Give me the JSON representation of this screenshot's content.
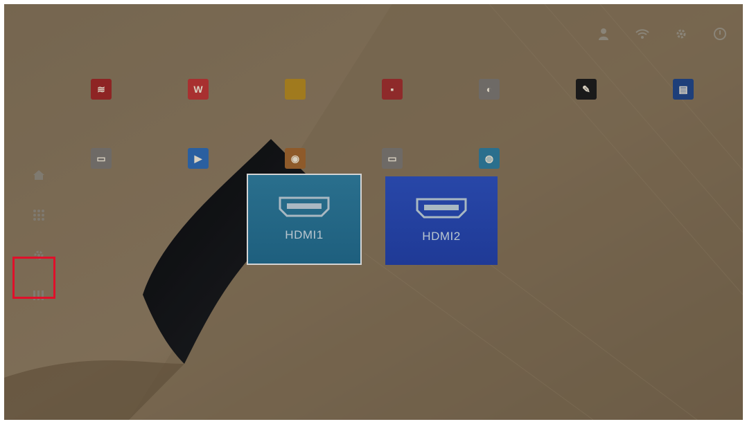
{
  "status_bar": {
    "icons": [
      "person-icon",
      "wifi-icon",
      "gear-icon",
      "power-icon"
    ]
  },
  "apps": {
    "row1": [
      {
        "label": "",
        "color": "#8e2424",
        "glyph": "≋"
      },
      {
        "label": "",
        "color": "#a83030",
        "glyph": "W"
      },
      {
        "label": "",
        "color": "#a07a1e",
        "glyph": ""
      },
      {
        "label": "",
        "color": "#8e2a2a",
        "glyph": "▪"
      },
      {
        "label": "",
        "color": "#6e6a66",
        "glyph": "◐"
      },
      {
        "label": "",
        "color": "#1a1a1a",
        "glyph": "✎"
      },
      {
        "label": "",
        "color": "#1e3f7a",
        "glyph": "▤"
      }
    ],
    "row2": [
      {
        "label": "",
        "color": "#6e6a66",
        "glyph": "▭"
      },
      {
        "label": "",
        "color": "#2a5fa0",
        "glyph": "▶"
      },
      {
        "label": "",
        "color": "#8e5a2a",
        "glyph": "◉"
      },
      {
        "label": "",
        "color": "#6e6a66",
        "glyph": "▭"
      },
      {
        "label": "",
        "color": "#2a6f8d",
        "glyph": "◍"
      }
    ]
  },
  "sidebar": {
    "items": [
      "home-icon",
      "apps-grid-icon",
      "gear-icon",
      "sources-icon"
    ]
  },
  "sources": [
    {
      "label": "HDMI1",
      "selected": true
    },
    {
      "label": "HDMI2",
      "selected": false
    }
  ],
  "colors": {
    "highlight": "#e0102a",
    "hdmi1": "#236883",
    "hdmi2": "#2443a0"
  }
}
